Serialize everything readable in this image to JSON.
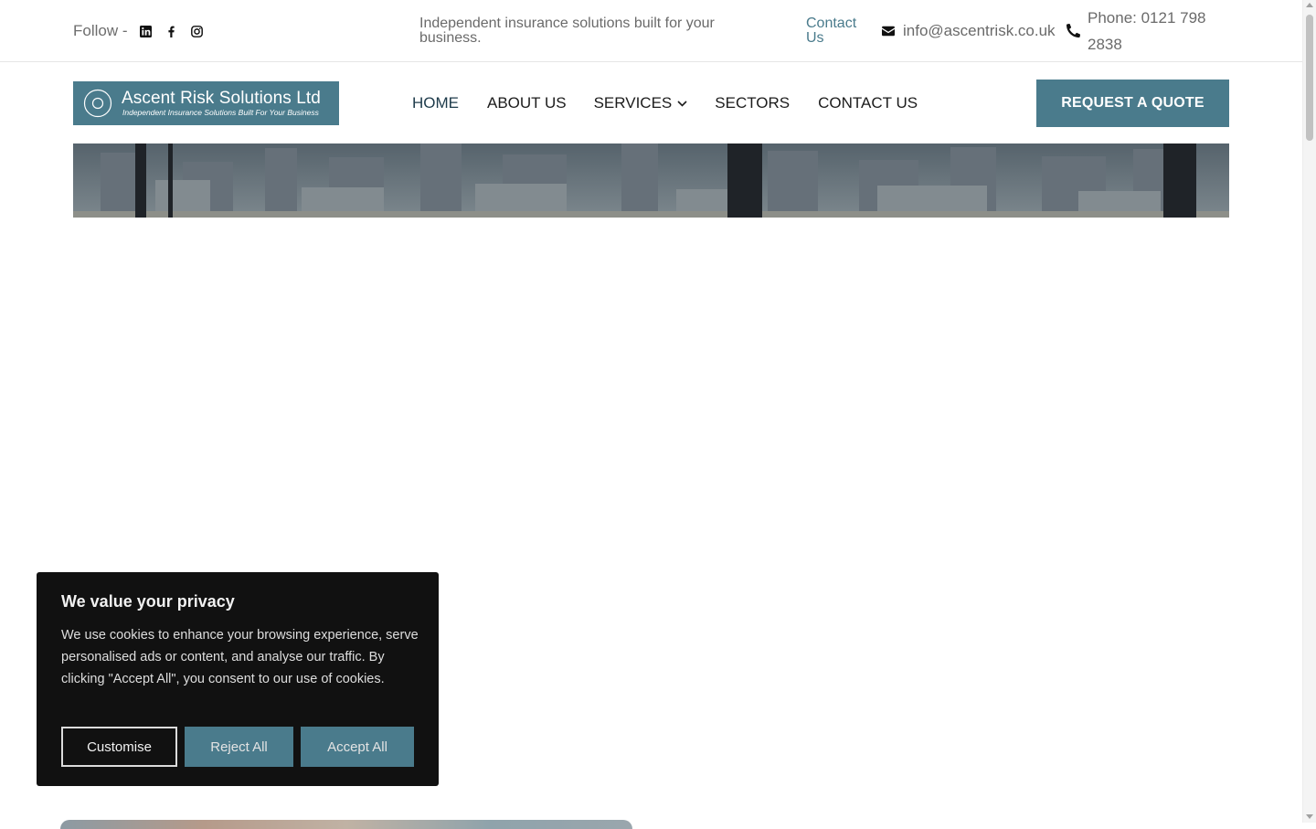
{
  "topbar": {
    "follow_label": "Follow -",
    "social": [
      {
        "icon": "linkedin-icon"
      },
      {
        "icon": "facebook-icon"
      },
      {
        "icon": "instagram-icon"
      }
    ],
    "tagline": "Independent insurance solutions built for your business.",
    "contact_link": "Contact Us",
    "email": "info@ascentrisk.co.uk",
    "phone": "Phone: 0121 798 2838"
  },
  "header": {
    "logo_name": "Ascent Risk Solutions Ltd",
    "logo_tagline": "Independent Insurance Solutions Built For Your Business",
    "nav": {
      "home": "HOME",
      "about": "ABOUT US",
      "services": "SERVICES",
      "sectors": "SECTORS",
      "contact": "CONTACT US"
    },
    "quote_button": "REQUEST A QUOTE"
  },
  "cookie_banner": {
    "title": "We value your privacy",
    "body": "We use cookies to enhance your browsing experience, serve personalised ads or content, and analyse our traffic. By clicking \"Accept All\", you consent to our use of cookies.",
    "customise": "Customise",
    "reject": "Reject All",
    "accept": "Accept All"
  },
  "colors": {
    "brand": "#4a7b8c",
    "banner_bg": "#111111",
    "text_muted": "#6a6a6a"
  }
}
